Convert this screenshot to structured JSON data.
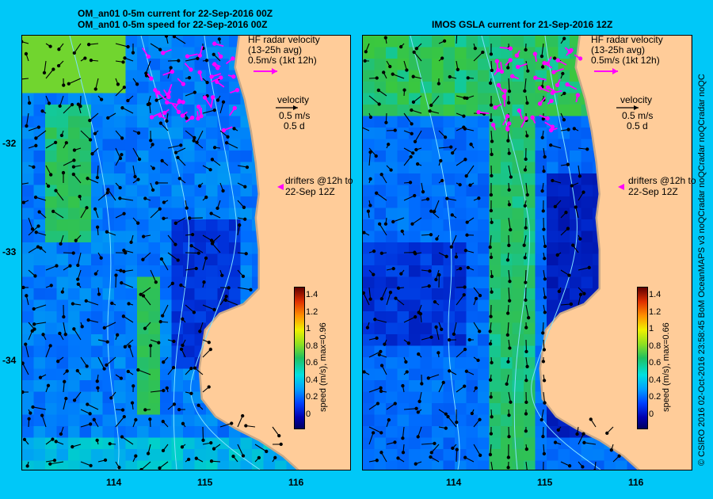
{
  "left": {
    "title1": "OM_an01 0-5m current for 22-Sep-2016 00Z",
    "title2": "OM_an01 0-5m speed for 22-Sep-2016 00Z",
    "hf_title": "HF radar velocity",
    "hf_sub": "(13-25h avg)",
    "hf_scale": "0.5m/s (1kt 12h)",
    "vel_title": "velocity",
    "vel_1": "0.5 m/s",
    "vel_2": "0.5 d",
    "drifters_1": "drifters @12h to",
    "drifters_2": "22-Sep 12Z",
    "cbar_label": "speed (m/s), max=0.96"
  },
  "right": {
    "title": "IMOS GSLA current for 21-Sep-2016 12Z",
    "hf_title": "HF radar velocity",
    "hf_sub": "(13-25h avg)",
    "hf_scale": "0.5m/s (1kt 12h)",
    "vel_title": "velocity",
    "vel_1": "0.5 m/s",
    "vel_2": "0.5 d",
    "drifters_1": "drifters @12h to",
    "drifters_2": "22-Sep 12Z",
    "cbar_label": "speed (m/s), max=0.66"
  },
  "colorbar_ticks": [
    "1.4",
    "1.2",
    "1",
    "0.8",
    "0.6",
    "0.4",
    "0.2",
    "0"
  ],
  "lat_ticks": [
    "-32",
    "-33",
    "-34"
  ],
  "lon_ticks": [
    "114",
    "115",
    "116"
  ],
  "credit": "© CSIRO 2016   02-Oct-2016 23:58:45 BoM OceanMAPS v3 noQCradar noQCradar noQCradar noQC",
  "colors": {
    "background": "#00c8f8",
    "land": "#ffcc99",
    "coast_shelf": "#c8a888",
    "hf_arrow": "#ff00ff"
  }
}
